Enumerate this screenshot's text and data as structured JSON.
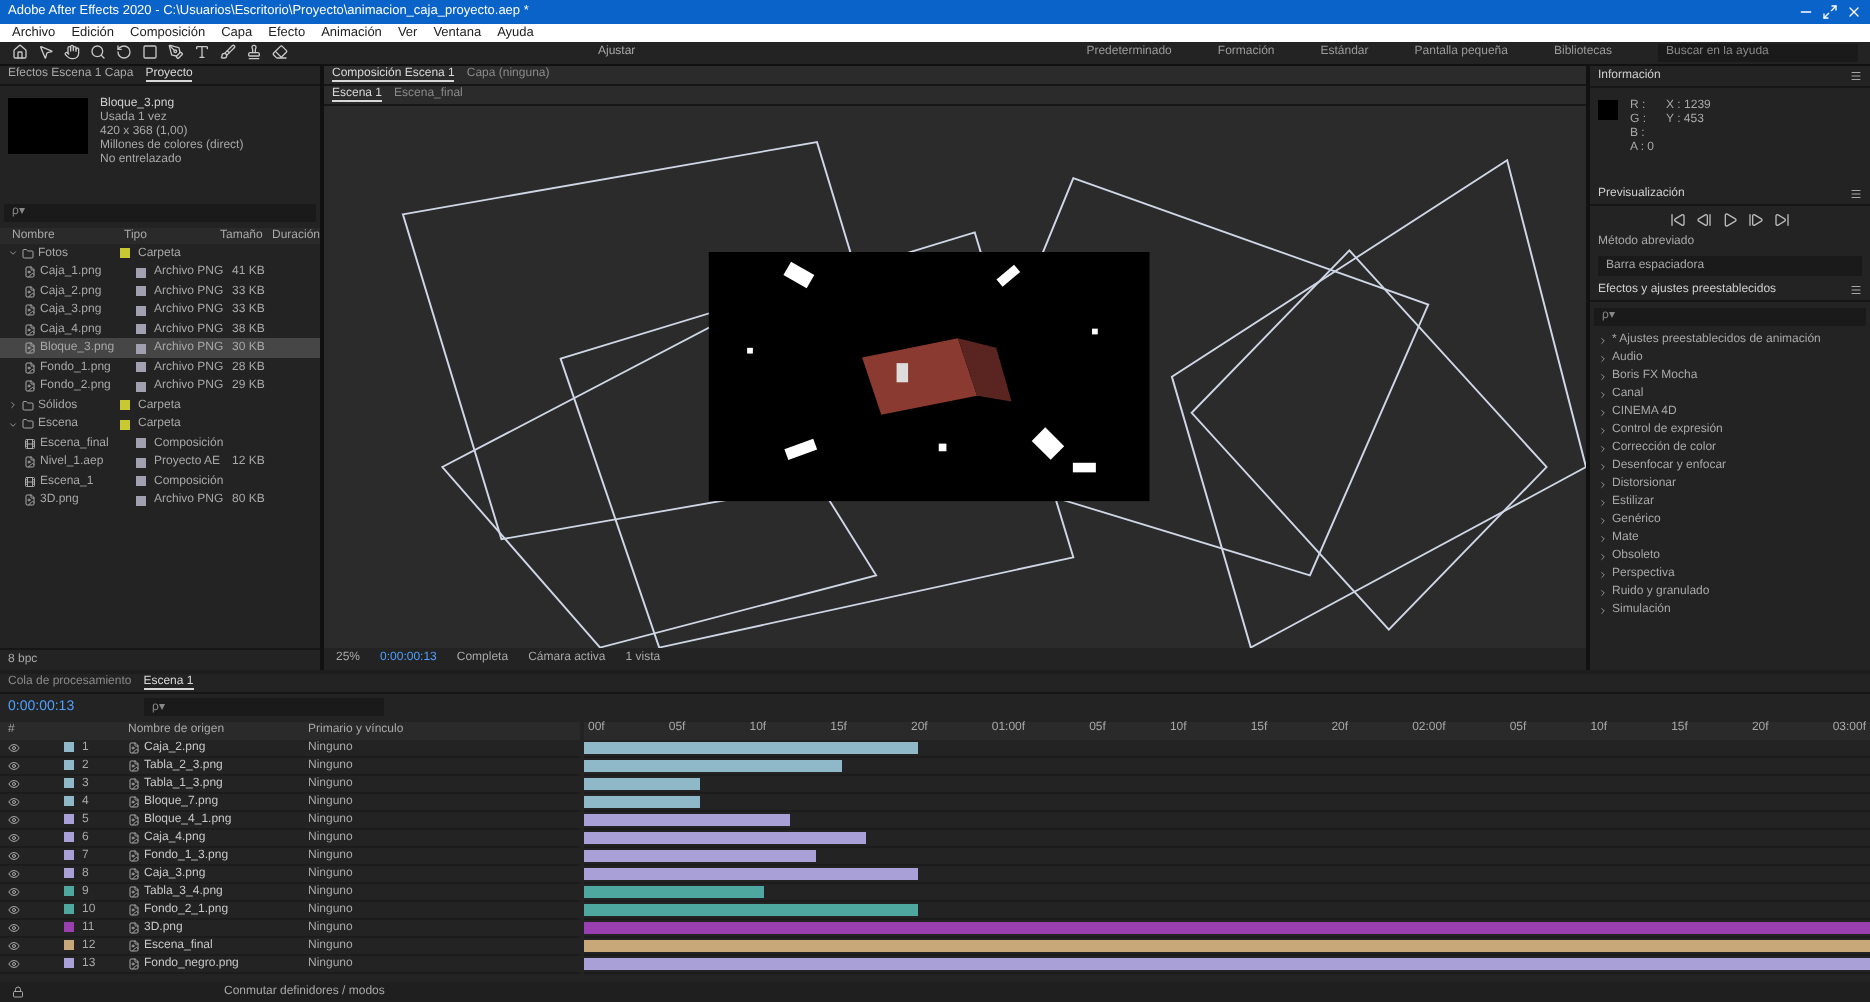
{
  "window": {
    "title": "Adobe After Effects 2020 - C:\\Usuarios\\Escritorio\\Proyecto\\animacion_caja_proyecto.aep *"
  },
  "menu": [
    "Archivo",
    "Edición",
    "Composición",
    "Capa",
    "Efecto",
    "Animación",
    "Ver",
    "Ventana",
    "Ayuda"
  ],
  "toolbar": {
    "snap_label": "Ajustar",
    "workspaces": [
      {
        "label": "Predeterminado",
        "selected": false
      },
      {
        "label": "Formación",
        "selected": false
      },
      {
        "label": "Estándar",
        "selected": false
      },
      {
        "label": "Pantalla pequeña",
        "selected": false
      },
      {
        "label": "Bibliotecas",
        "selected": false
      }
    ],
    "help_search": {
      "placeholder": "Buscar en la ayuda"
    }
  },
  "project": {
    "panel_tab": "Proyecto",
    "header_path": "Efectos Escena 1 Capa",
    "selected_item": "Bloque_3.png",
    "usage": "Usada 1 vez",
    "dimensions": "420 x 368 (1,00)",
    "colors": "Millones de colores (direct)",
    "interlace": "No entrelazado",
    "search": {
      "placeholder": "ρ▾"
    },
    "columns": [
      "Nombre",
      "Tipo",
      "Tamaño",
      "Duración"
    ],
    "items": [
      {
        "name": "Fotos",
        "kind": "folder",
        "type": "Carpeta",
        "expanded": true,
        "selected": false,
        "children": [
          {
            "name": "Caja_1.png",
            "kind": "file",
            "type": "Archivo PNG",
            "size": "41 KB",
            "selected": false
          },
          {
            "name": "Caja_2.png",
            "kind": "file",
            "type": "Archivo PNG",
            "size": "33 KB",
            "selected": false
          },
          {
            "name": "Caja_3.png",
            "kind": "file",
            "type": "Archivo PNG",
            "size": "33 KB",
            "selected": false
          },
          {
            "name": "Caja_4.png",
            "kind": "file",
            "type": "Archivo PNG",
            "size": "38 KB",
            "selected": false
          },
          {
            "name": "Bloque_3.png",
            "kind": "file",
            "type": "Archivo PNG",
            "size": "30 KB",
            "selected": true
          },
          {
            "name": "Fondo_1.png",
            "kind": "file",
            "type": "Archivo PNG",
            "size": "28 KB",
            "selected": false
          },
          {
            "name": "Fondo_2.png",
            "kind": "file",
            "type": "Archivo PNG",
            "size": "29 KB",
            "selected": false
          }
        ]
      },
      {
        "name": "Sólidos",
        "kind": "folder",
        "type": "Carpeta",
        "expanded": false,
        "selected": false
      },
      {
        "name": "Escena",
        "kind": "folder",
        "type": "Carpeta",
        "expanded": true,
        "selected": false,
        "children": [
          {
            "name": "Escena_final",
            "kind": "comp",
            "type": "Composición",
            "selected": false
          },
          {
            "name": "Nivel_1.aep",
            "kind": "file",
            "type": "Proyecto AE",
            "size": "12 KB",
            "selected": false
          },
          {
            "name": "Escena_1",
            "kind": "comp",
            "type": "Composición",
            "selected": false
          },
          {
            "name": "3D.png",
            "kind": "file",
            "type": "Archivo PNG",
            "size": "80 KB",
            "selected": false
          }
        ]
      }
    ],
    "bottom_label": "8 bpc"
  },
  "viewer": {
    "tabs": [
      {
        "label": "Composición Escena 1",
        "selected": true
      },
      {
        "label": "Capa (ninguna)",
        "selected": false
      }
    ],
    "subtabs": [
      {
        "label": "Escena 1",
        "selected": true
      },
      {
        "label": "Escena_final",
        "selected": false
      }
    ],
    "bar": [
      "25%",
      "0:00:00:13",
      "Completa",
      "Cámara activa",
      "1 vista"
    ]
  },
  "info_panel": {
    "title": "Información",
    "readings": [
      "R :",
      "G :",
      "B :",
      "A : 0"
    ],
    "coords": [
      "X : 1239",
      "Y : 453"
    ]
  },
  "preview_panel": {
    "title": "Previsualización",
    "shortcut_label": "Método abreviado",
    "shortcut": "Barra espaciadora"
  },
  "effects_panel": {
    "title": "Efectos y ajustes preestablecidos",
    "search": {
      "placeholder": "ρ▾"
    },
    "categories": [
      "* Ajustes preestablecidos de animación",
      "Audio",
      "Boris FX Mocha",
      "Canal",
      "CINEMA 4D",
      "Control de expresión",
      "Corrección de color",
      "Desenfocar y enfocar",
      "Distorsionar",
      "Estilizar",
      "Genérico",
      "Mate",
      "Obsoleto",
      "Perspectiva",
      "Ruido y granulado",
      "Simulación"
    ]
  },
  "timeline": {
    "tabs": [
      {
        "label": "Cola de procesamiento",
        "selected": false
      },
      {
        "label": "Escena 1",
        "selected": true
      }
    ],
    "timecode": "0:00:00:13",
    "search": {
      "placeholder": "ρ▾"
    },
    "columns": [
      "#",
      "Nombre de origen",
      "Primario y vínculo"
    ],
    "ticks": [
      "00f",
      "05f",
      "10f",
      "15f",
      "20f",
      "01:00f",
      "05f",
      "10f",
      "15f",
      "20f",
      "02:00f",
      "05f",
      "10f",
      "15f",
      "20f",
      "03:00f"
    ],
    "layers": [
      {
        "number": "1",
        "name": "Caja_2.png",
        "parent": "Ninguno",
        "color": "#8fb8c8",
        "level": 0.26
      },
      {
        "number": "2",
        "name": "Tabla_2_3.png",
        "parent": "Ninguno",
        "color": "#8fb8c8",
        "level": 0.2
      },
      {
        "number": "3",
        "name": "Tabla_1_3.png",
        "parent": "Ninguno",
        "color": "#8fb8c8",
        "level": 0.09
      },
      {
        "number": "4",
        "name": "Bloque_7.png",
        "parent": "Ninguno",
        "color": "#8fb8c8",
        "level": 0.09
      },
      {
        "number": "5",
        "name": "Bloque_4_1.png",
        "parent": "Ninguno",
        "color": "#a9a0d8",
        "level": 0.16
      },
      {
        "number": "6",
        "name": "Caja_4.png",
        "parent": "Ninguno",
        "color": "#a9a0d8",
        "level": 0.22
      },
      {
        "number": "7",
        "name": "Fondo_1_3.png",
        "parent": "Ninguno",
        "color": "#a9a0d8",
        "level": 0.18
      },
      {
        "number": "8",
        "name": "Caja_3.png",
        "parent": "Ninguno",
        "color": "#a9a0d8",
        "level": 0.26
      },
      {
        "number": "9",
        "name": "Tabla_3_4.png",
        "parent": "Ninguno",
        "color": "#4fa8a0",
        "level": 0.14
      },
      {
        "number": "10",
        "name": "Fondo_2_1.png",
        "parent": "Ninguno",
        "color": "#4fa8a0",
        "level": 0.26
      },
      {
        "number": "11",
        "name": "3D.png",
        "parent": "Ninguno",
        "color": "#9a3fb0",
        "level": 1
      },
      {
        "number": "12",
        "name": "Escena_final",
        "parent": "Ninguno",
        "color": "#c8a878",
        "level": 1
      },
      {
        "number": "13",
        "name": "Fondo_negro.png",
        "parent": "Ninguno",
        "color": "#a9a0d8",
        "level": 1
      }
    ],
    "status": "Conmutar definidores / modos"
  }
}
